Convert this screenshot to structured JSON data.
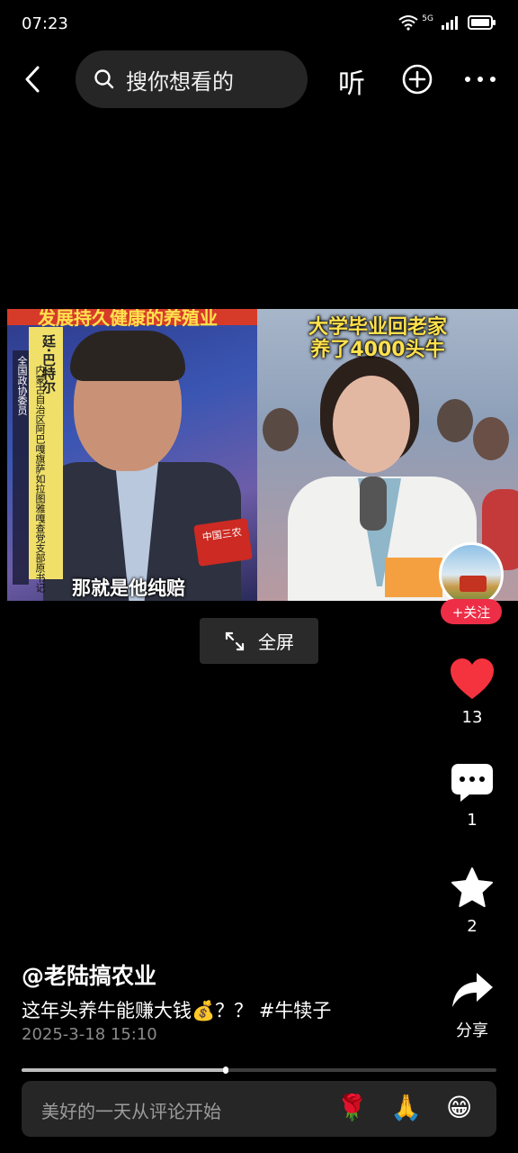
{
  "status_bar": {
    "time": "07:23",
    "network": "5G"
  },
  "top_bar": {
    "search_placeholder": "搜你想看的",
    "listen_label": "听"
  },
  "video": {
    "left_banner": "发展持久健康的养殖业",
    "left_name": "廷·巴特尔",
    "left_role": "全国政协委员",
    "left_org": "内蒙古自治区阿巴嘎旗萨如拉图雅嘎查党支部原书记",
    "left_caption": "那就是他纯赔",
    "mic_label": "中国三农",
    "right_title_line1": "大学毕业回老家",
    "right_title_line2": "养了4000头牛"
  },
  "follow_label": "+关注",
  "fullscreen_label": "全屏",
  "actions": {
    "like_count": "13",
    "comment_count": "1",
    "favorite_count": "2",
    "share_label": "分享"
  },
  "post": {
    "author": "@老陆搞农业",
    "description": "这年头养牛能赚大钱💰？？ #牛犊子",
    "date": "2025-3-18 15:10"
  },
  "progress": {
    "played_fraction": 0.43
  },
  "comment": {
    "placeholder": "美好的一天从评论开始",
    "emojis": [
      "🌹",
      "🙏",
      "😁"
    ]
  },
  "colors": {
    "like_red": "#f5333f",
    "follow_red": "#ee2e47",
    "background": "#000000"
  }
}
